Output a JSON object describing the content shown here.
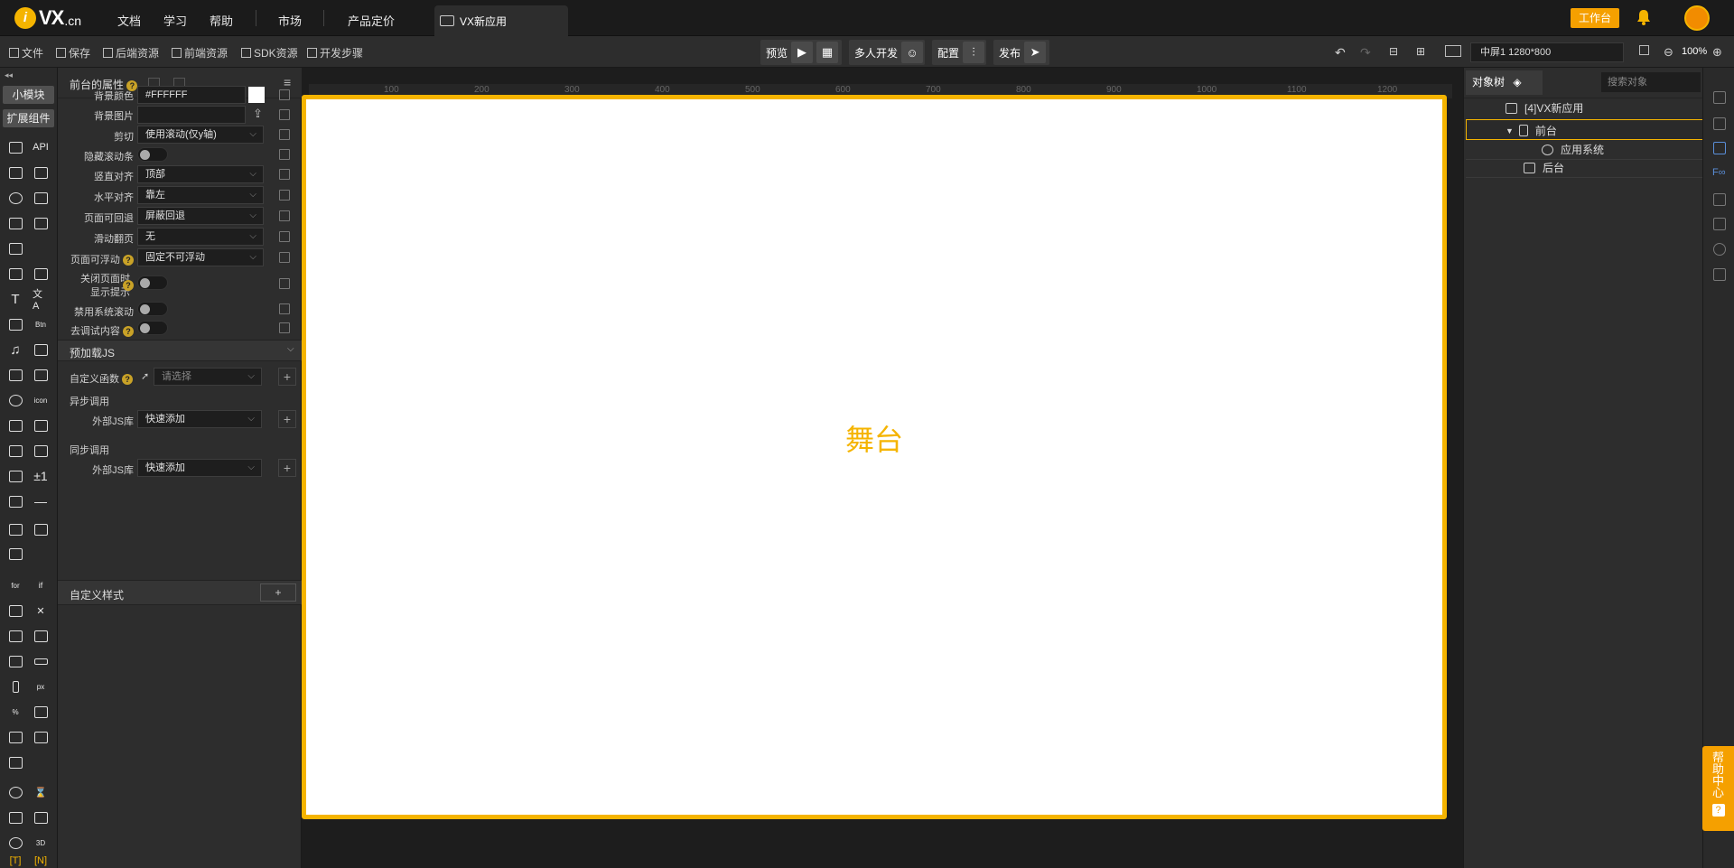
{
  "nav": {
    "logo_letter": "i",
    "logo_text": "VX",
    "logo_domain": ".cn",
    "items": [
      "文档",
      "学习",
      "帮助",
      "市场",
      "产品定价"
    ],
    "active_tab": "VX新应用",
    "workbench": "工作台"
  },
  "toolbar": {
    "left_items": [
      "文件",
      "保存",
      "后端资源",
      "前端资源",
      "SDK资源",
      "开发步骤"
    ],
    "preview": "预览",
    "multi_dev": "多人开发",
    "config": "配置",
    "publish": "发布",
    "screen": "中屏1 1280*800",
    "zoom": "100%"
  },
  "leftcol": {
    "tab_small": "小模块",
    "tab_ext": "扩展组件",
    "api_label": "API"
  },
  "props": {
    "title": "前台的属性",
    "rows": [
      {
        "label": "背景颜色",
        "value": "#FFFFFF"
      },
      {
        "label": "背景图片",
        "value": ""
      },
      {
        "label": "剪切",
        "value": "使用滚动(仅y轴)"
      },
      {
        "label": "隐藏滚动条",
        "value": ""
      },
      {
        "label": "竖直对齐",
        "value": "顶部"
      },
      {
        "label": "水平对齐",
        "value": "靠左"
      },
      {
        "label": "页面可回退",
        "value": "屏蔽回退"
      },
      {
        "label": "滑动翻页",
        "value": "无"
      },
      {
        "label": "页面可浮动",
        "value": "固定不可浮动"
      },
      {
        "label": "关闭页面时",
        "value": ""
      },
      {
        "label": "显示提示",
        "value": ""
      },
      {
        "label": "禁用系统滚动",
        "value": ""
      },
      {
        "label": "去调试内容",
        "value": ""
      }
    ],
    "section_preload": "预加载JS",
    "custom_func_label": "自定义函数",
    "custom_func_placeholder": "请选择",
    "async_label": "异步调用",
    "sync_label": "同步调用",
    "extjs_label": "外部JS库",
    "extjs_value": "快速添加",
    "section_style": "自定义样式",
    "plus": "+"
  },
  "ruler": [
    "100",
    "200",
    "300",
    "400",
    "500",
    "600",
    "700",
    "800",
    "900",
    "1000",
    "1100",
    "1200"
  ],
  "stage": {
    "label": "舞台"
  },
  "tree": {
    "tab": "对象树",
    "search_placeholder": "搜索对象",
    "nodes": [
      "[4]VX新应用",
      "前台",
      "应用系统",
      "后台"
    ]
  },
  "help": {
    "label": "帮助中心",
    "q": "?"
  },
  "colors": {
    "accent": "#f5b400",
    "bg_dark": "#1e1e1e",
    "panel": "#2d2d2d"
  }
}
